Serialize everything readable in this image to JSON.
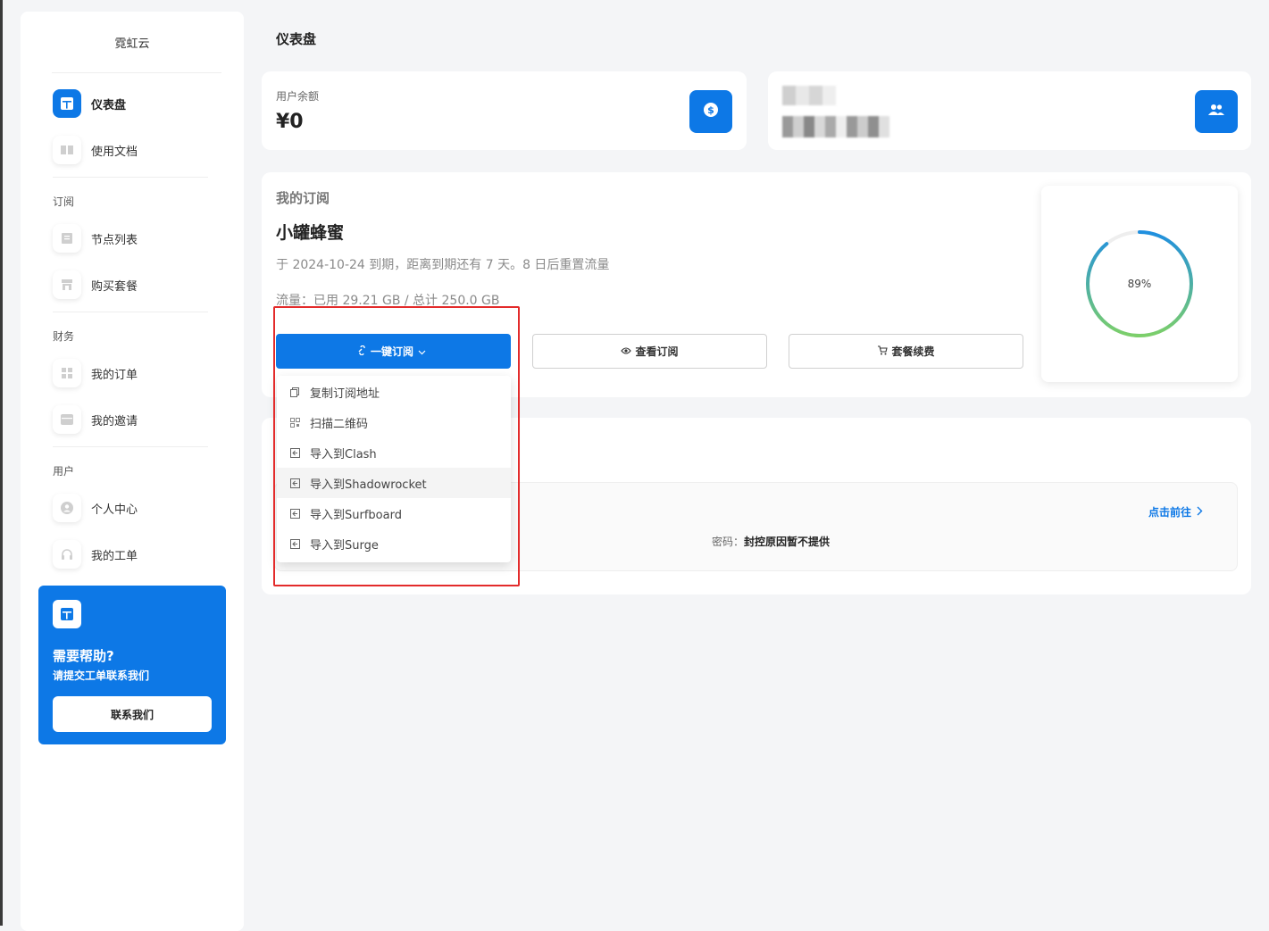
{
  "app": {
    "brand": "霓虹云"
  },
  "sidebar": {
    "items_top": [
      {
        "label": "仪表盘",
        "icon": "dashboard-icon",
        "active": true
      },
      {
        "label": "使用文档",
        "icon": "book-icon"
      }
    ],
    "sections": [
      {
        "title": "订阅",
        "items": [
          {
            "label": "节点列表",
            "icon": "list-icon"
          },
          {
            "label": "购买套餐",
            "icon": "store-icon"
          }
        ]
      },
      {
        "title": "财务",
        "items": [
          {
            "label": "我的订单",
            "icon": "grid-icon"
          },
          {
            "label": "我的邀请",
            "icon": "calendar-icon"
          }
        ]
      },
      {
        "title": "用户",
        "items": [
          {
            "label": "个人中心",
            "icon": "user-circle-icon"
          },
          {
            "label": "我的工单",
            "icon": "headset-icon"
          }
        ]
      }
    ],
    "help": {
      "title": "需要帮助?",
      "subtitle": "请提交工单联系我们",
      "button": "联系我们"
    }
  },
  "header": {
    "title": "仪表盘"
  },
  "balance": {
    "label": "用户余额",
    "value": "¥0"
  },
  "subscription": {
    "section_label": "我的订阅",
    "plan_name": "小罐蜂蜜",
    "expire_text": "于 2024-10-24 到期，距离到期还有 7 天。8 日后重置流量",
    "traffic_text": "流量：已用 29.21 GB / 总计 250.0 GB",
    "usage_percent_label": "89%",
    "usage_fraction": 0.89,
    "buttons": {
      "one_click": "一键订阅",
      "view": "查看订阅",
      "renew": "套餐续费"
    }
  },
  "dropdown": {
    "items": [
      {
        "label": "复制订阅地址",
        "icon": "copy-icon"
      },
      {
        "label": "扫描二维码",
        "icon": "qrcode-icon"
      },
      {
        "label": "导入到Clash",
        "icon": "import-icon"
      },
      {
        "label": "导入到Shadowrocket",
        "icon": "import-icon"
      },
      {
        "label": "导入到Surfboard",
        "icon": "import-icon"
      },
      {
        "label": "导入到Surge",
        "icon": "import-icon"
      }
    ]
  },
  "notice": {
    "goto_label": "点击前往",
    "password_label": "密码：",
    "password_value": "封控原因暂不提供"
  },
  "colors": {
    "primary": "#0d78e6",
    "gauge_start": "#7ccf6a",
    "gauge_end": "#1f8fe0",
    "highlight": "#e32b2b"
  }
}
